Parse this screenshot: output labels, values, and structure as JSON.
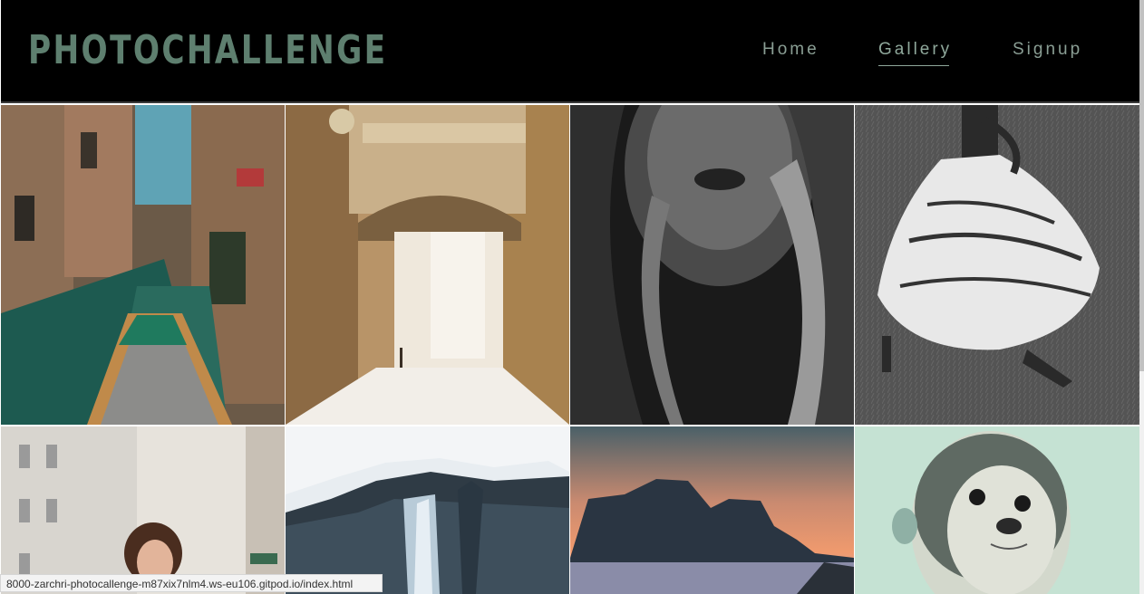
{
  "header": {
    "brand": "PHOTOCHALLENGE",
    "nav": {
      "home": "Home",
      "gallery": "Gallery",
      "signup": "Signup"
    }
  },
  "gallery": {
    "images": [
      {
        "name": "venice-canal-photo"
      },
      {
        "name": "venice-alley-bridge-photo"
      },
      {
        "name": "woman-face-bw-photo"
      },
      {
        "name": "woman-dress-grass-bw-photo"
      },
      {
        "name": "woman-street-photo"
      },
      {
        "name": "waterfall-snow-photo"
      },
      {
        "name": "rock-sunset-photo"
      },
      {
        "name": "seal-photo"
      }
    ]
  },
  "statusbar": {
    "url": "8000-zarchri-photocallenge-m87xix7nlm4.ws-eu106.gitpod.io/index.html"
  },
  "colors": {
    "brand": "#5e7f6f",
    "nav": "#8a9e94",
    "header_bg": "#000000"
  }
}
